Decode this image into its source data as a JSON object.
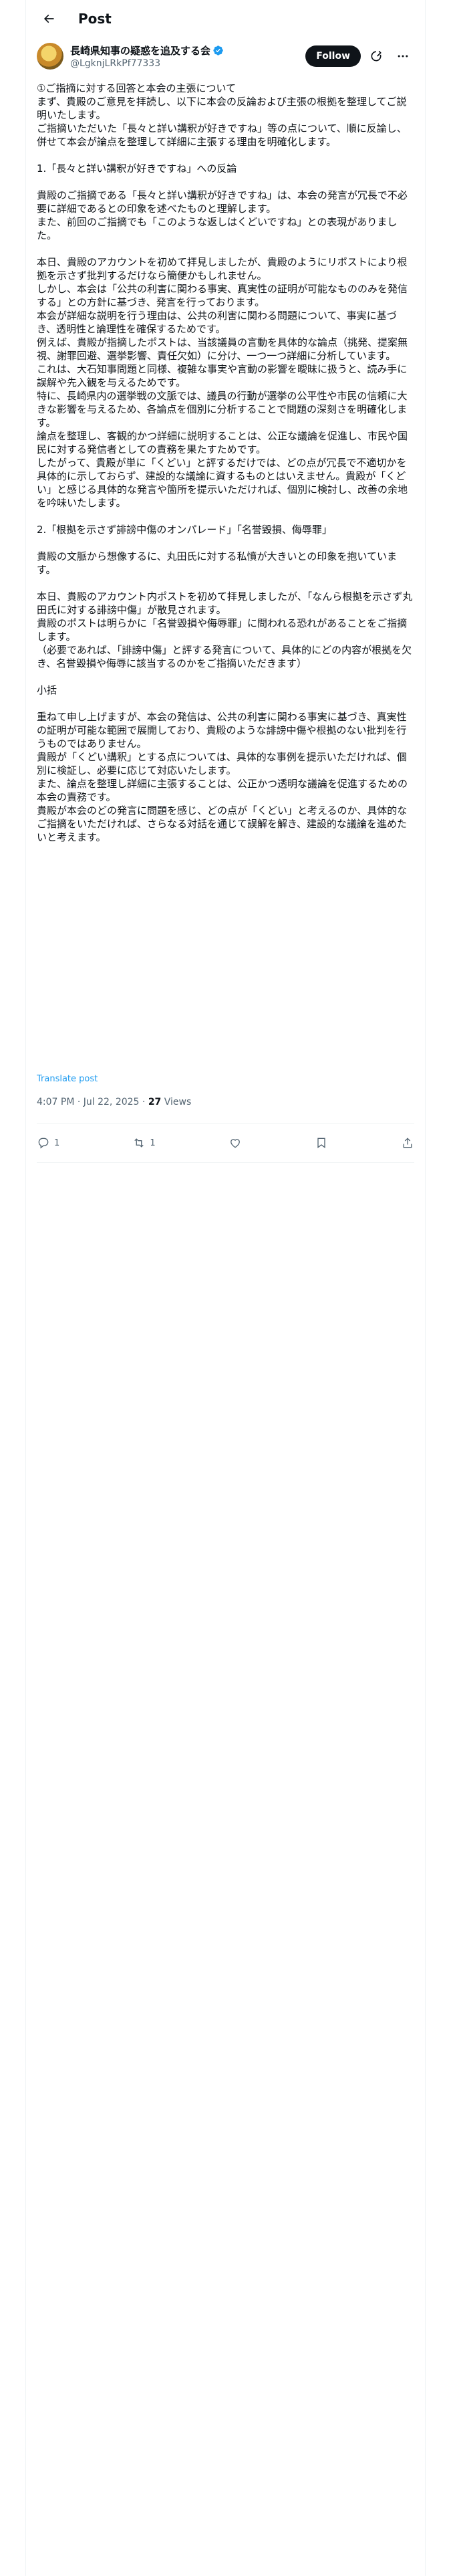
{
  "header": {
    "title": "Post"
  },
  "author": {
    "name": "長崎県知事の疑惑を追及する会",
    "handle": "@LgknjLRkPf77333",
    "follow_label": "Follow"
  },
  "tweet": {
    "text": "①ご指摘に対する回答と本会の主張について\nまず、貴殿のご意見を拝読し、以下に本会の反論および主張の根拠を整理してご説明いたします。\nご指摘いただいた「長々と詳い講釈が好きですね」等の点について、順に反論し、併せて本会が論点を整理して詳細に主張する理由を明確化します。\n\n1.「長々と詳い講釈が好きですね」への反論\n\n貴殿のご指摘である「長々と詳い講釈が好きですね」は、本会の発言が冗長で不必要に詳細であるとの印象を述べたものと理解します。\nまた、前回のご指摘でも「このような返しはくどいですね」との表現がありました。\n\n本日、貴殿のアカウントを初めて拝見しましたが、貴殿のようにリポストにより根拠を示さず批判するだけなら簡便かもしれません。\nしかし、本会は「公共の利害に関わる事実、真実性の証明が可能なもののみを発信する」との方針に基づき、発言を行っております。\n本会が詳細な説明を行う理由は、公共の利害に関わる問題について、事実に基づき、透明性と論理性を確保するためです。\n例えば、貴殿が指摘したポストは、当該議員の言動を具体的な論点（挑発、提案無視、謝罪回避、選挙影響、責任欠如）に分け、一つ一つ詳細に分析しています。\nこれは、大石知事問題と同様、複雑な事実や言動の影響を曖昧に扱うと、読み手に誤解や先入観を与えるためです。\n特に、長崎県内の選挙戦の文脈では、議員の行動が選挙の公平性や市民の信頼に大きな影響を与えるため、各論点を個別に分析することで問題の深刻さを明確化します。\n論点を整理し、客観的かつ詳細に説明することは、公正な議論を促進し、市民や国民に対する発信者としての責務を果たすためです。\nしたがって、貴殿が単に「くどい」と評するだけでは、どの点が冗長で不適切かを具体的に示しておらず、建設的な議論に資するものとはいえません。貴殿が「くどい」と感じる具体的な発言や箇所を提示いただければ、個別に検討し、改善の余地を吟味いたします。\n\n2.「根拠を示さず誹謗中傷のオンパレード」「名誉毀損、侮辱罪」\n\n貴殿の文脈から想像するに、丸田氏に対する私憤が大きいとの印象を抱いています。\n\n本日、貴殿のアカウント内ポストを初めて拝見しましたが、「なんら根拠を示さず丸田氏に対する誹謗中傷」が散見されます。\n貴殿のポストは明らかに「名誉毀損や侮辱罪」に問われる恐れがあることをご指摘します。\n（必要であれば、「誹謗中傷」と評する発言について、具体的にどの内容が根拠を欠き、名誉毀損や侮辱に該当するのかをご指摘いただきます）\n\n小括\n\n重ねて申し上げますが、本会の発信は、公共の利害に関わる事実に基づき、真実性の証明が可能な範囲で展開しており、貴殿のような誹謗中傷や根拠のない批判を行うものではありません。\n貴殿が「くどい講釈」とする点については、具体的な事例を提示いただければ、個別に検証し、必要に応じて対応いたします。\nまた、論点を整理し詳細に主張することは、公正かつ透明な議論を促進するための本会の責務です。\n貴殿が本会のどの発言に問題を感じ、どの点が「くどい」と考えるのか、具体的なご指摘をいただければ、さらなる対話を通じて誤解を解き、建設的な議論を進めたいと考えます。",
    "translate_label": "Translate post",
    "timestamp": "4:07 PM · Jul 22, 2025",
    "separator": " · ",
    "views_count": "27",
    "views_label": " Views"
  },
  "actions": {
    "reply_count": "1",
    "repost_count": "1"
  },
  "colors": {
    "accent": "#1d9bf0",
    "text_primary": "#0f1419",
    "text_secondary": "#536471",
    "border": "#eff3f4"
  },
  "icons": [
    "back-arrow-icon",
    "verified-badge-icon",
    "grok-icon",
    "more-icon",
    "reply-icon",
    "repost-icon",
    "like-icon",
    "bookmark-icon",
    "share-icon"
  ]
}
